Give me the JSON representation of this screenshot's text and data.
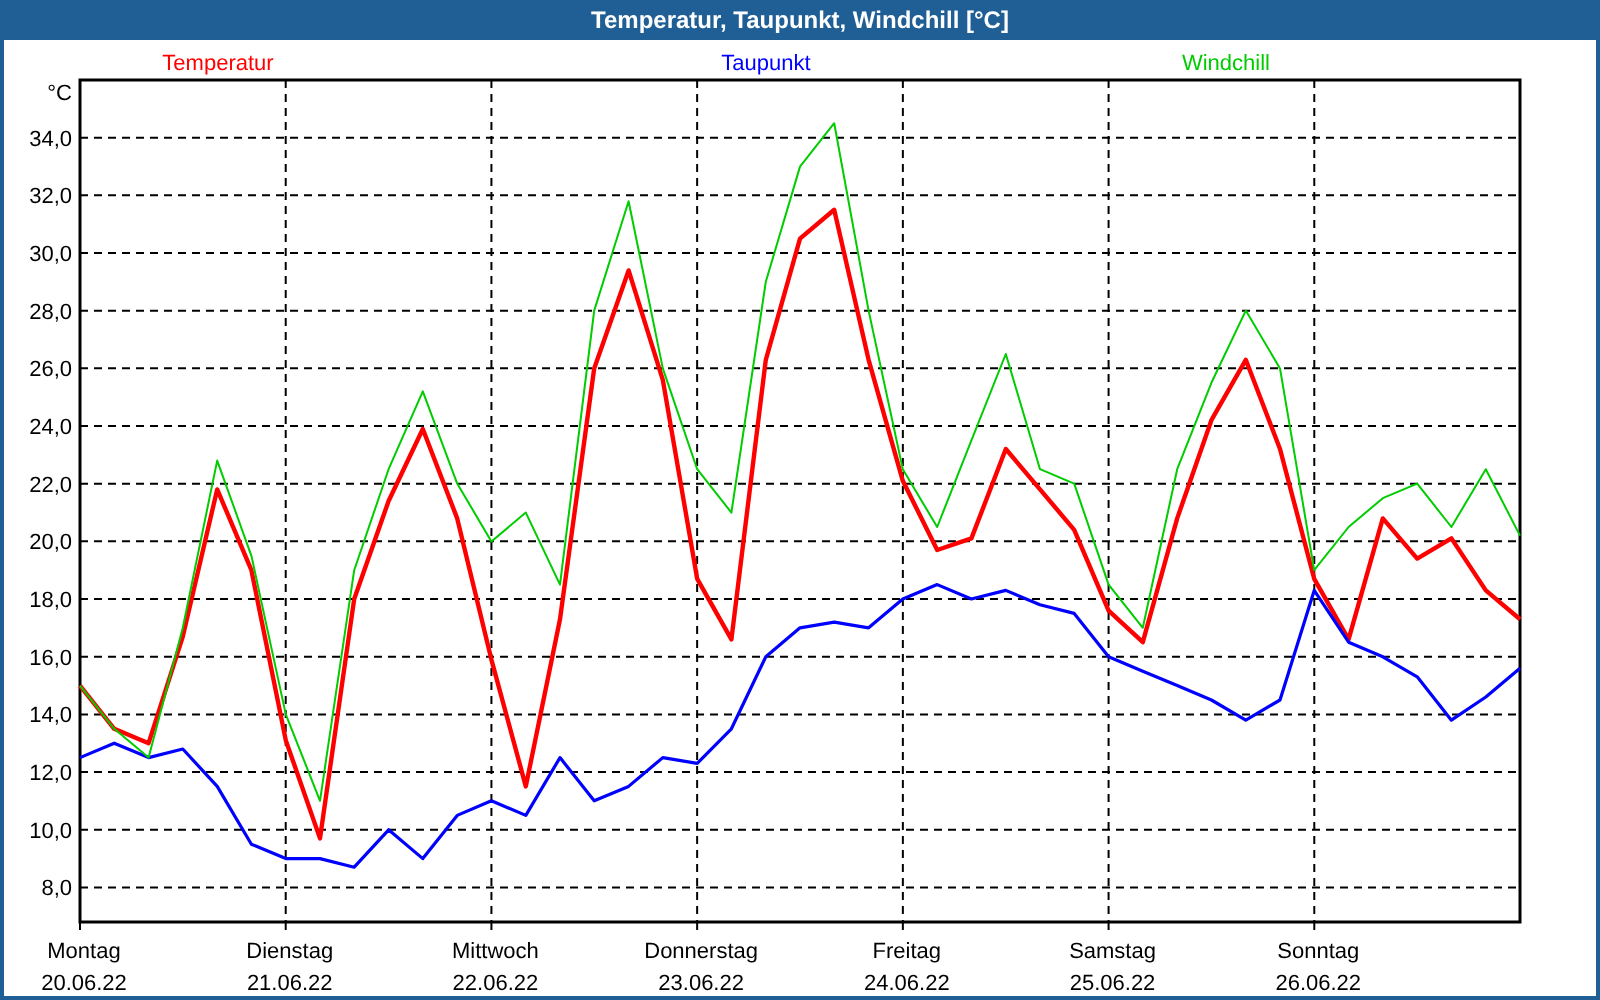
{
  "window": {
    "title": "Temperatur, Taupunkt, Windchill [°C]"
  },
  "chart": {
    "chart_data": {
      "type": "line",
      "grid": true,
      "ylabel": "°C",
      "ylim": [
        6.8,
        36
      ],
      "categories": [
        "Montag 20.06.22",
        null,
        null,
        null,
        null,
        null,
        "Dienstag 21.06.22",
        null,
        null,
        null,
        null,
        null,
        "Mittwoch 22.06.22",
        null,
        null,
        null,
        null,
        null,
        "Donnerstag 23.06.22",
        null,
        null,
        null,
        null,
        null,
        "Freitag 24.06.22",
        null,
        null,
        null,
        null,
        null,
        "Samstag 25.06.22",
        null,
        null,
        null,
        null,
        null,
        "Sonntag 26.06.22",
        null,
        null,
        null,
        null,
        null,
        null
      ],
      "series": [
        {
          "name": "Temperatur",
          "color": "#ff0000",
          "values": [
            15.0,
            13.5,
            13.0,
            16.7,
            21.8,
            19.0,
            13.1,
            9.7,
            18.0,
            21.4,
            23.9,
            20.8,
            15.9,
            11.5,
            17.3,
            26.0,
            29.4,
            25.6,
            18.7,
            16.6,
            26.3,
            30.5,
            31.5,
            26.3,
            22.1,
            19.7,
            20.1,
            23.2,
            21.8,
            20.4,
            17.6,
            16.5,
            20.8,
            24.2,
            26.3,
            23.2,
            18.7,
            16.6,
            20.8,
            19.4,
            20.1,
            18.3,
            17.3
          ]
        },
        {
          "name": "Taupunkt",
          "color": "#0000ff",
          "values": [
            12.5,
            13.0,
            12.5,
            12.8,
            11.5,
            9.5,
            9.0,
            9.0,
            8.7,
            10.0,
            9.0,
            10.5,
            11.0,
            10.5,
            12.5,
            11.0,
            11.5,
            12.5,
            12.3,
            13.5,
            16.0,
            17.0,
            17.2,
            17.0,
            18.0,
            18.5,
            18.0,
            18.3,
            17.8,
            17.5,
            16.0,
            15.5,
            15.0,
            14.5,
            13.8,
            14.5,
            18.3,
            16.5,
            16.0,
            15.3,
            13.8,
            14.6,
            15.6
          ]
        },
        {
          "name": "Windchill",
          "color": "#00cc00",
          "values": [
            15.0,
            13.5,
            12.5,
            17.0,
            22.8,
            19.5,
            14.0,
            11.0,
            19.0,
            22.5,
            25.2,
            22.0,
            20.0,
            21.0,
            18.5,
            28.0,
            31.8,
            26.0,
            22.5,
            21.0,
            29.0,
            33.0,
            34.5,
            28.0,
            22.5,
            20.5,
            23.5,
            26.5,
            22.5,
            22.0,
            18.5,
            17.0,
            22.5,
            25.5,
            28.0,
            26.0,
            19.0,
            20.5,
            21.5,
            22.0,
            20.5,
            22.5,
            20.2
          ]
        }
      ],
      "yticks": [
        {
          "value": 8,
          "label": "8,0"
        },
        {
          "value": 10,
          "label": "10,0"
        },
        {
          "value": 12,
          "label": "12,0"
        },
        {
          "value": 14,
          "label": "14,0"
        },
        {
          "value": 16,
          "label": "16,0"
        },
        {
          "value": 18,
          "label": "18,0"
        },
        {
          "value": 20,
          "label": "20,0"
        },
        {
          "value": 22,
          "label": "22,0"
        },
        {
          "value": 24,
          "label": "24,0"
        },
        {
          "value": 26,
          "label": "26,0"
        },
        {
          "value": 28,
          "label": "28,0"
        },
        {
          "value": 30,
          "label": "30,0"
        },
        {
          "value": 32,
          "label": "32,0"
        },
        {
          "value": 34,
          "label": "34,0"
        }
      ]
    }
  }
}
